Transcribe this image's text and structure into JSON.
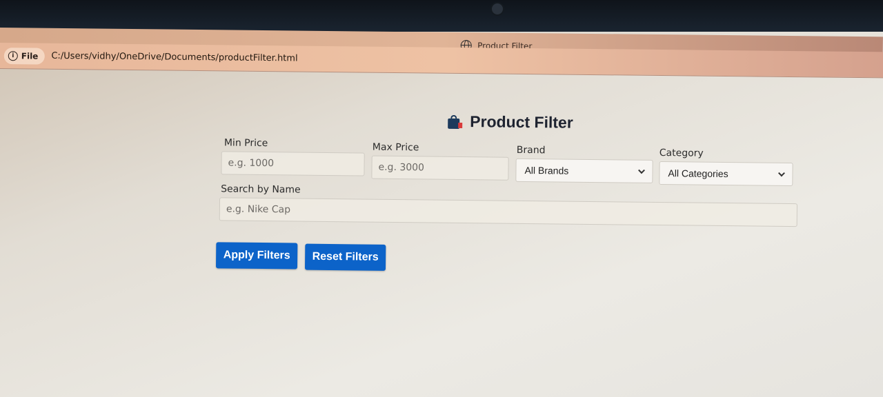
{
  "browser": {
    "tab_title": "Product Filter",
    "file_chip": "File",
    "url": "C:/Users/vidhy/OneDrive/Documents/productFilter.html"
  },
  "page": {
    "title": "Product Filter",
    "title_icon": "shopping-bag-icon",
    "filters": {
      "min_price": {
        "label": "Min Price",
        "placeholder": "e.g. 1000"
      },
      "max_price": {
        "label": "Max Price",
        "placeholder": "e.g. 3000"
      },
      "brand": {
        "label": "Brand",
        "selected": "All Brands"
      },
      "category": {
        "label": "Category",
        "selected": "All Categories"
      },
      "search": {
        "label": "Search by Name",
        "placeholder": "e.g. Nike Cap"
      }
    },
    "buttons": {
      "apply": "Apply Filters",
      "reset": "Reset Filters"
    }
  },
  "colors": {
    "primary_button": "#0c63c9",
    "heading_text": "#1e2330"
  }
}
